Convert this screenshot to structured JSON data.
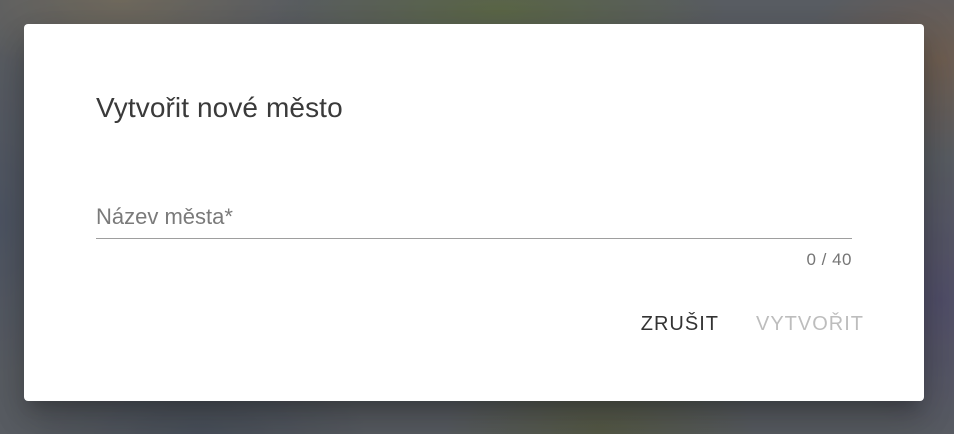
{
  "dialog": {
    "title": "Vytvořit nové město",
    "field": {
      "placeholder": "Název města*",
      "value": "",
      "counter": "0 / 40"
    },
    "actions": {
      "cancel_label": "ZRUŠIT",
      "create_label": "VYTVOŘIT",
      "create_disabled": true
    }
  },
  "colors": {
    "dialog_background": "#ffffff",
    "title_text": "#3a3a3a",
    "underline": "#9e9e9e",
    "disabled_button_text": "#bdbdbd"
  }
}
